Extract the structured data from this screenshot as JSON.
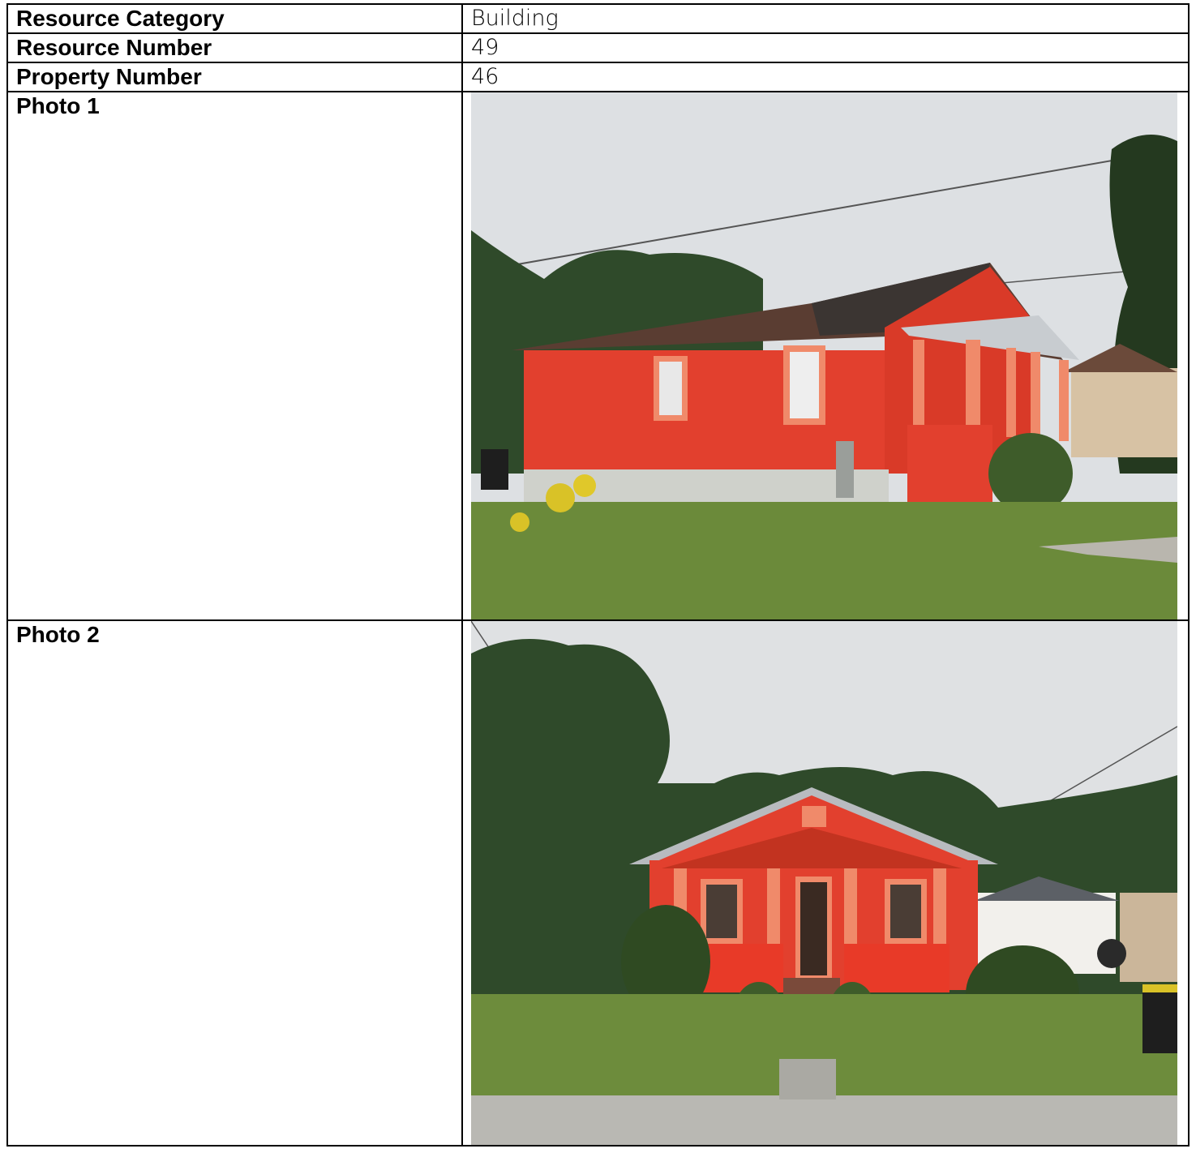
{
  "rows": {
    "category": {
      "label": "Resource Category",
      "value": "Building"
    },
    "resource_number": {
      "label": "Resource Number",
      "value": "49"
    },
    "property_number": {
      "label": "Property Number",
      "value": "46"
    },
    "photo1": {
      "label": "Photo 1"
    },
    "photo2": {
      "label": "Photo 2"
    }
  },
  "colors": {
    "house_red": "#e2402e",
    "trim_salmon": "#f08a6a",
    "sky": "#dde0e3",
    "grass": "#6b8a3a",
    "trees": "#2f4a2a"
  }
}
